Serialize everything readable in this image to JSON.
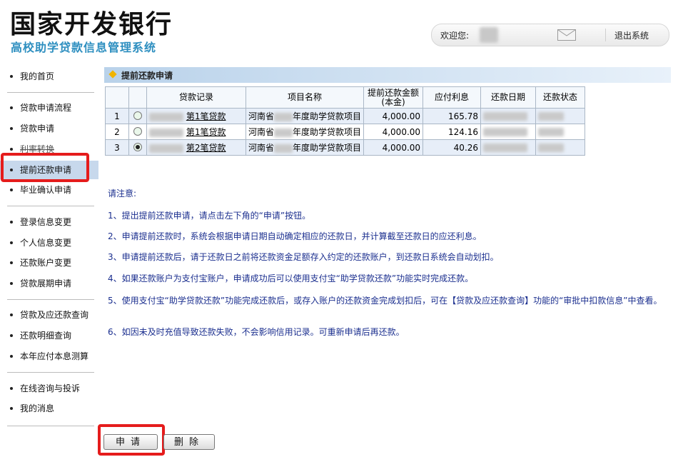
{
  "header": {
    "title": "国家开发银行",
    "subtitle": "高校助学贷款信息管理系统",
    "welcome": "欢迎您:",
    "logout": "退出系统",
    "mail_icon": "envelope-icon"
  },
  "sidebar": {
    "groups": [
      [
        "我的首页"
      ],
      [
        "贷款申请流程",
        "贷款申请",
        "利率转换",
        "提前还款申请",
        "毕业确认申请"
      ],
      [
        "登录信息变更",
        "个人信息变更",
        "还款账户变更",
        "贷款展期申请"
      ],
      [
        "贷款及应还款查询",
        "还款明细查询",
        "本年应付本息测算"
      ],
      [
        "在线咨询与投诉",
        "我的消息"
      ]
    ],
    "active": "提前还款申请"
  },
  "section": {
    "title": "提前还款申请"
  },
  "table": {
    "headers": [
      "贷款记录",
      "项目名称",
      "提前还款金额(本金)",
      "应付利息",
      "还款日期",
      "还款状态"
    ],
    "rows": [
      {
        "idx": "1",
        "loan_prefix": "第1笔贷款",
        "project_left": "河南省",
        "project_right": "年度助学贷款项目",
        "amount": "4,000.00",
        "interest": "165.78",
        "selected": false
      },
      {
        "idx": "2",
        "loan_prefix": "第1笔贷款",
        "project_left": "河南省",
        "project_right": "年度助学贷款项目",
        "amount": "4,000.00",
        "interest": "124.16",
        "selected": false
      },
      {
        "idx": "3",
        "loan_prefix": "第2笔贷款",
        "project_left": "河南省",
        "project_right": "年度助学贷款项目",
        "amount": "4,000.00",
        "interest": "40.26",
        "selected": true
      }
    ]
  },
  "notes": {
    "heading": "请注意:",
    "items": [
      "1、提出提前还款申请，请点击左下角的“申请”按钮。",
      "2、申请提前还款时，系统会根据申请日期自动确定相应的还款日，并计算截至还款日的应还利息。",
      "3、申请提前还款后，请于还款日之前将还款资金足额存入约定的还款账户，到还款日系统会自动划扣。",
      "4、如果还款账户为支付宝账户，申请成功后可以使用支付宝“助学贷款还款”功能实时完成还款。",
      "5、使用支付宝“助学贷款还款”功能完成还款后，或存入账户的还款资金完成划扣后，可在【贷款及应还款查询】功能的“审批中扣款信息”中查看。",
      "6、如因未及时充值导致还款失败，不会影响信用记录。可重新申请后再还款。"
    ]
  },
  "buttons": {
    "apply": "申请",
    "delete": "删除"
  },
  "colors": {
    "highlight_box": "#e51c1c",
    "note_text": "#1b2f8f",
    "subtitle": "#2e8fc0"
  }
}
